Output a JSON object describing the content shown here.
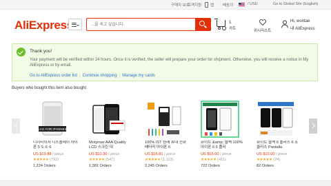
{
  "topbar": {
    "buyer_protection": "구매자 보호",
    "customer_service": "고객지원",
    "app": "앱",
    "ship_to": "배송지",
    "currency": "/ USD",
    "global_site": "Go to Global Site (English)"
  },
  "header": {
    "logo": "AliExpress",
    "search_placeholder": "...을 세고 싶습니다.",
    "cart_count": "1",
    "cart_label": "카트",
    "wishlist_label": "위시리스트",
    "greeting": "Hi, wontae",
    "my_account": "내 AliExpress"
  },
  "thank_you": {
    "title": "Thank you!",
    "message": "Your payment will be verified within 24 hours. Once it is verified, the seller will prepare your order for shipment. Otherwise, you will receive a notice in My AliExpress or by email.",
    "links": [
      "Go to AliExpress order list",
      "Continue shopping",
      "Manage my cards"
    ]
  },
  "also_bought": {
    "title": "Buyers who bought this item also bought",
    "items": [
      {
        "name": "디지타이저 디스플레이 아이폰 5 S 소 6",
        "price": "US $13.88",
        "unit": "/ piece",
        "rating": "(792)",
        "orders": "1,224 Orders"
      },
      {
        "name": "Motymax AAA Quality LCD 스크린 대",
        "price": "US $10.30",
        "unit": "/ piece",
        "rating": "(547)",
        "orders": "1,381 Orders"
      },
      {
        "name": "100% IST 원래 휴대 전화 배터리 아이폰 6",
        "price": "US $16.81",
        "unit": "/ piece",
        "rating": "(1,113)",
        "orders": "2,245 Orders"
      },
      {
        "name": "화이트 &amp; 블랙 100% 아이폰 6 6 플러",
        "price": "US $15.00",
        "unit": "/ piece",
        "rating": "(411)",
        "orders": "722 Orders"
      },
      {
        "name": "화이트 블랙 6 플러스 6 조 클러스 Pantalla",
        "price": "US $10.00",
        "unit": "/ piece",
        "rating": "(24)",
        "orders": "82 Orders"
      }
    ]
  },
  "colors": {
    "brand": "#e62e04",
    "link": "#2b74c7",
    "success_bg": "#f1fbe6",
    "success_icon": "#6cbf2a",
    "star": "#f5a623"
  }
}
